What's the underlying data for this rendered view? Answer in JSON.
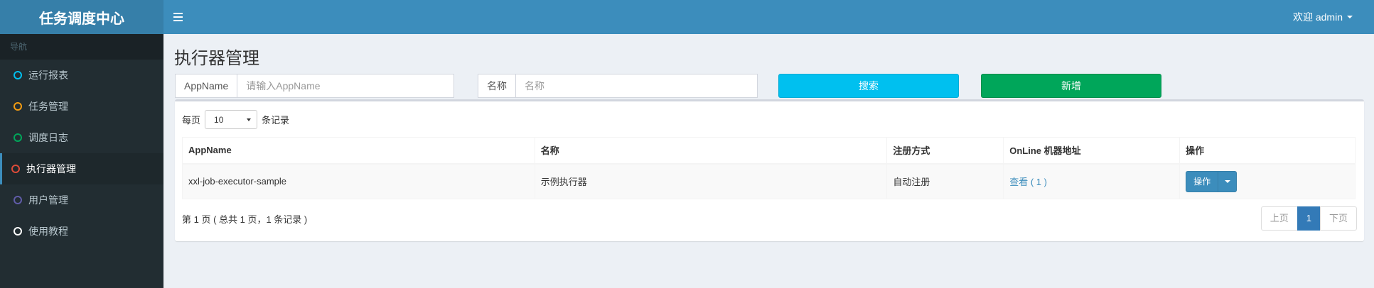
{
  "app": {
    "title": "任务调度中心"
  },
  "colors": {
    "header": "#3c8dbc",
    "sidebar": "#222d32",
    "search": "#00c0ef",
    "add": "#00a65a",
    "primary": "#3c8dbc"
  },
  "header": {
    "menu_icon": "hamburger-icon",
    "user": "欢迎 admin"
  },
  "sidebar": {
    "header": "导航",
    "items": [
      {
        "label": "运行报表",
        "color": "#00c0ef",
        "active": false
      },
      {
        "label": "任务管理",
        "color": "#f39c12",
        "active": false
      },
      {
        "label": "调度日志",
        "color": "#00a65a",
        "active": false
      },
      {
        "label": "执行器管理",
        "color": "#dd4b39",
        "active": true
      },
      {
        "label": "用户管理",
        "color": "#605ca8",
        "active": false
      },
      {
        "label": "使用教程",
        "color": "#ffffff",
        "active": false
      }
    ]
  },
  "main": {
    "title": "执行器管理",
    "filters": {
      "appname_label": "AppName",
      "appname_placeholder": "请输入AppName",
      "title_label": "名称",
      "title_placeholder": "名称"
    },
    "buttons": {
      "search": "搜索",
      "add": "新增"
    },
    "length": {
      "prefix": "每页",
      "value": "10",
      "suffix": "条记录"
    },
    "table": {
      "headers": [
        "AppName",
        "名称",
        "注册方式",
        "OnLine 机器地址",
        "操作"
      ],
      "rows": [
        {
          "appname": "xxl-job-executor-sample",
          "title": "示例执行器",
          "type": "自动注册",
          "address": "查看 ( 1 )",
          "action": "操作"
        }
      ]
    },
    "info": "第 1 页 ( 总共 1 页，1 条记录 )",
    "pager": {
      "prev": "上页",
      "current": "1",
      "next": "下页"
    }
  }
}
